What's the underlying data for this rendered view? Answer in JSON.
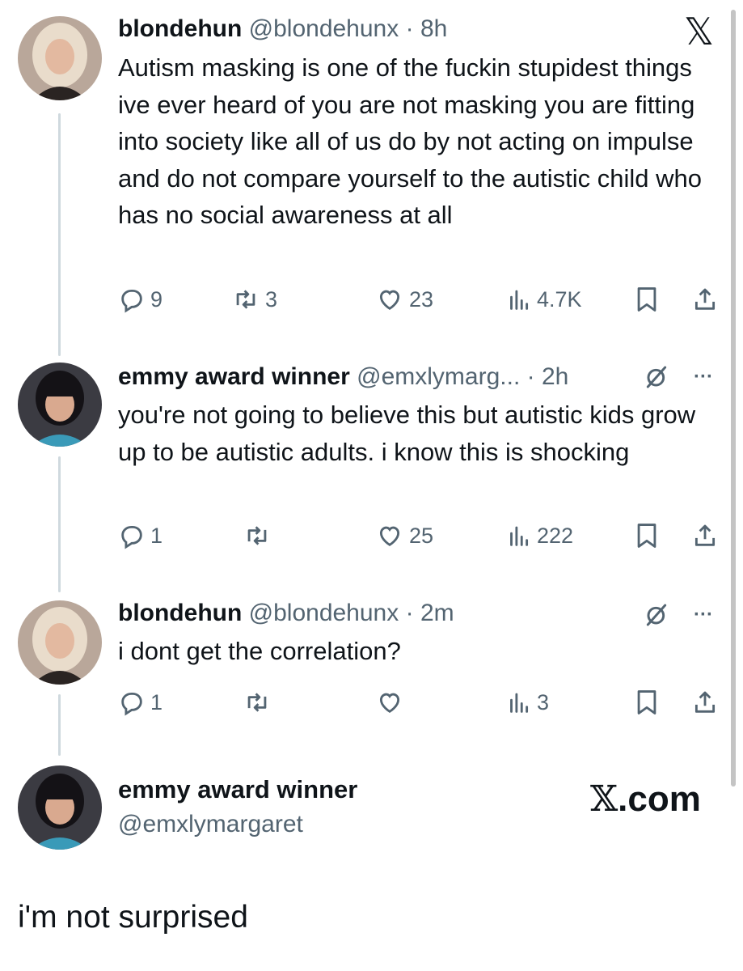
{
  "brand": {
    "x_logo": "𝕏",
    "x_com_glyph": "𝕏",
    "x_com_suffix": ".com"
  },
  "tweets": [
    {
      "name": "blondehun",
      "handle": "@blondehunx",
      "time": "8h",
      "text": "Autism masking is one of the fuckin stupidest things ive ever heard of you are not masking you are fitting into society like all of us do by not acting on impulse and do not compare yourself to the autistic child who has no social awareness at all",
      "replies": "9",
      "reposts": "3",
      "likes": "23",
      "views": "4.7K"
    },
    {
      "name": "emmy award winner",
      "handle": "@emxlymarg...",
      "time": "2h",
      "text": "you're not going to believe this but autistic kids grow up to be autistic adults. i know this is shocking",
      "replies": "1",
      "reposts": "",
      "likes": "25",
      "views": "222"
    },
    {
      "name": "blondehun",
      "handle": "@blondehunx",
      "time": "2m",
      "text": "i dont get the correlation?",
      "replies": "1",
      "reposts": "",
      "likes": "",
      "views": "3"
    }
  ],
  "final_author": {
    "name": "emmy award winner",
    "handle": "@emxlymargaret"
  },
  "caption": "i'm not surprised",
  "separator": "·",
  "more_label": "···",
  "colors": {
    "text": "#0f1419",
    "muted": "#536471",
    "line": "#cfd9de"
  }
}
